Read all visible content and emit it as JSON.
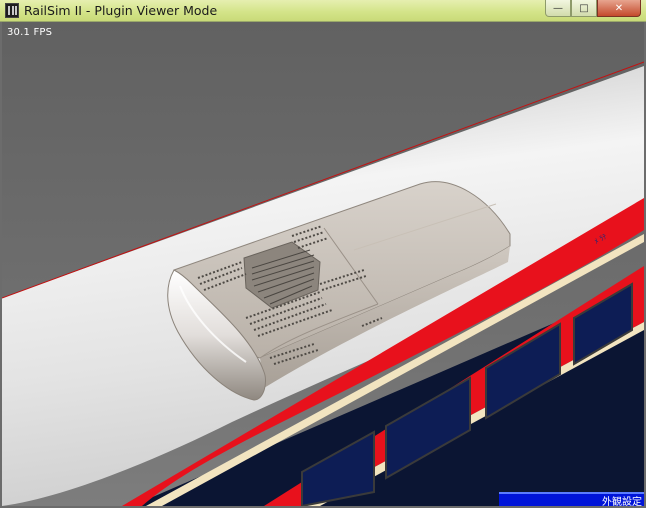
{
  "window": {
    "title": "RailSim II - Plugin Viewer Mode",
    "minimize_label": "—",
    "maximize_label": "□",
    "close_label": "✕"
  },
  "viewer": {
    "fps_text": "30.1 FPS",
    "status_text": "外観設定"
  },
  "icons": {
    "app": "railsim-app-icon",
    "minimize": "minimize-icon",
    "maximize": "maximize-icon",
    "close": "close-icon"
  },
  "colors": {
    "titlebar": "#d4e48a",
    "viewport_background": "#6c6c6c",
    "train_stripe": "#e8111c",
    "status_bar": "#0014d8"
  }
}
